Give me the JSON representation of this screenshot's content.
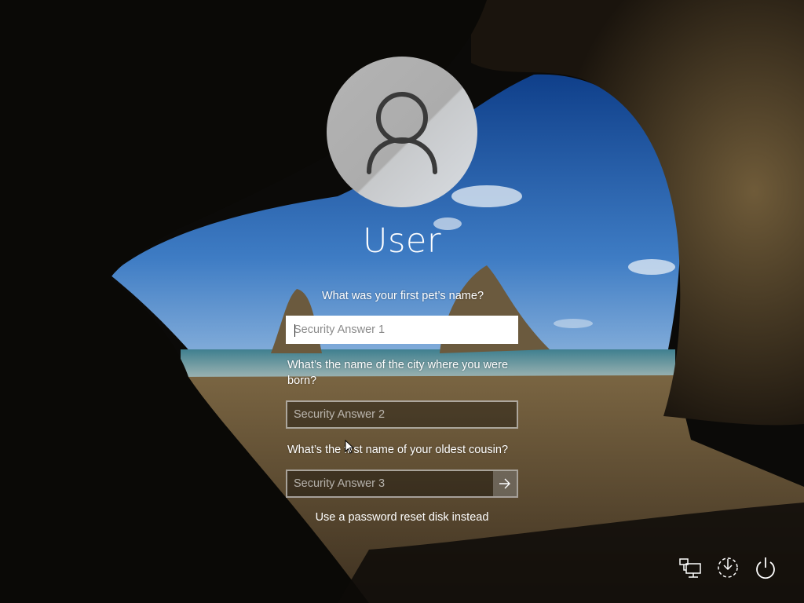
{
  "user": {
    "name": "User"
  },
  "questions": [
    {
      "label": "What was your first pet’s name?",
      "placeholder": "Security Answer 1",
      "value": ""
    },
    {
      "label": "What’s the name of the city where you were born?",
      "placeholder": "Security Answer 2",
      "value": ""
    },
    {
      "label": "What’s the first name of your oldest cousin?",
      "placeholder": "Security Answer 3",
      "value": ""
    }
  ],
  "links": {
    "reset_disk": "Use a password reset disk instead"
  },
  "system_icons": [
    "network-icon",
    "ease-of-access-icon",
    "power-icon"
  ],
  "colors": {
    "text": "#ffffff",
    "field_focus_bg": "#ffffff",
    "submit_bg": "rgba(255,255,255,0.25)"
  }
}
